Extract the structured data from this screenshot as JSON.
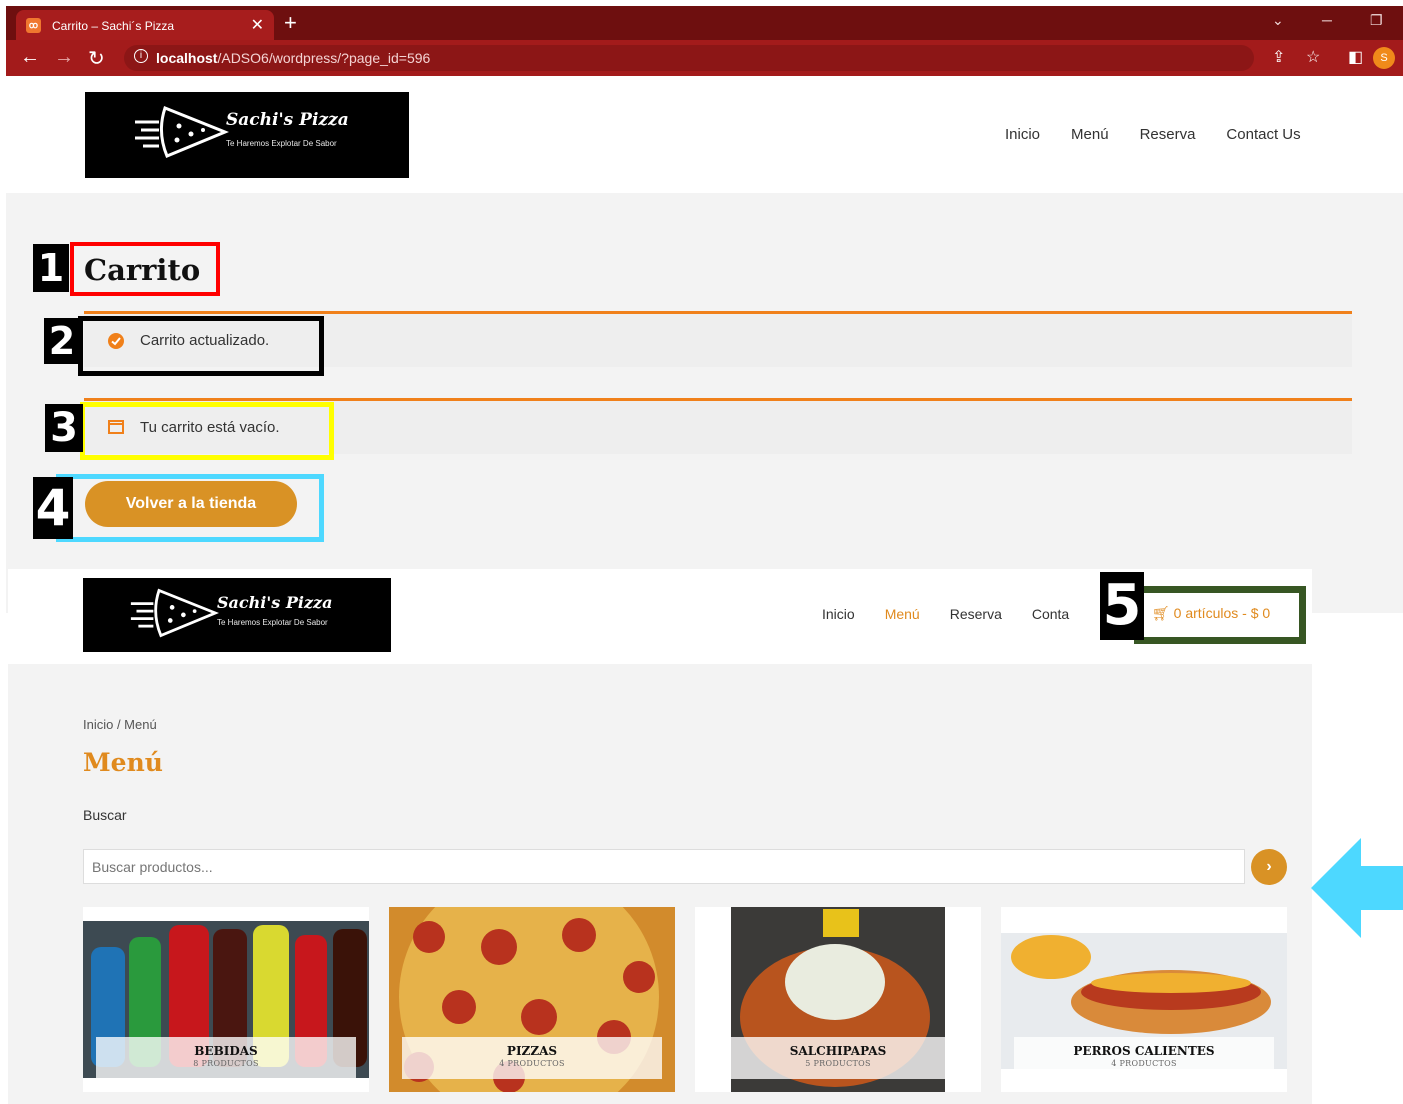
{
  "browser": {
    "tab_title": "Carrito – Sachi´s Pizza",
    "favicon_text": "ꝏ",
    "tab_close": "✕",
    "new_tab": "+",
    "url_host": "localhost",
    "url_path": "/ADSO6/wordpress/?page_id=596",
    "profile_initial": "S",
    "icons": [
      "back-icon",
      "forward-icon",
      "reload-icon",
      "info-icon",
      "share-icon",
      "star-icon",
      "sidepanel-icon",
      "profile-avatar"
    ]
  },
  "site": {
    "logo_title": "Sachi's Pizza",
    "logo_tagline": "Te Haremos Explotar De Sabor"
  },
  "screen1": {
    "nav": [
      "Inicio",
      "Menú",
      "Reserva",
      "Contact Us"
    ],
    "page_title": "Carrito",
    "notice_updated": "Carrito actualizado.",
    "notice_empty": "Tu carrito está vacío.",
    "return_button": "Volver a la tienda"
  },
  "screen2": {
    "nav": [
      "Inicio",
      "Menú",
      "Reserva",
      "Conta"
    ],
    "cart_link": "0 artículos - $ 0",
    "breadcrumb": "Inicio / Menú",
    "title": "Menú",
    "search_label": "Buscar",
    "search_placeholder": "Buscar productos...",
    "search_button": "›",
    "categories": [
      {
        "name": "BEBIDAS",
        "count": "8 PRODUCTOS"
      },
      {
        "name": "PIZZAS",
        "count": "4 PRODUCTOS"
      },
      {
        "name": "SALCHIPAPAS",
        "count": "5 PRODUCTOS"
      },
      {
        "name": "PERROS CALIENTES",
        "count": "4 PRODUCTOS"
      }
    ]
  },
  "annotations": {
    "labels": [
      "1",
      "2",
      "3",
      "4",
      "5"
    ],
    "colors": {
      "1": "#ff0000",
      "2": "#000000",
      "3": "#ffff00",
      "4": "#4dd8ff",
      "5": "#375623"
    }
  },
  "colors": {
    "accent": "#e08a1e",
    "button": "#d99225",
    "chrome": "#a31b1b"
  }
}
